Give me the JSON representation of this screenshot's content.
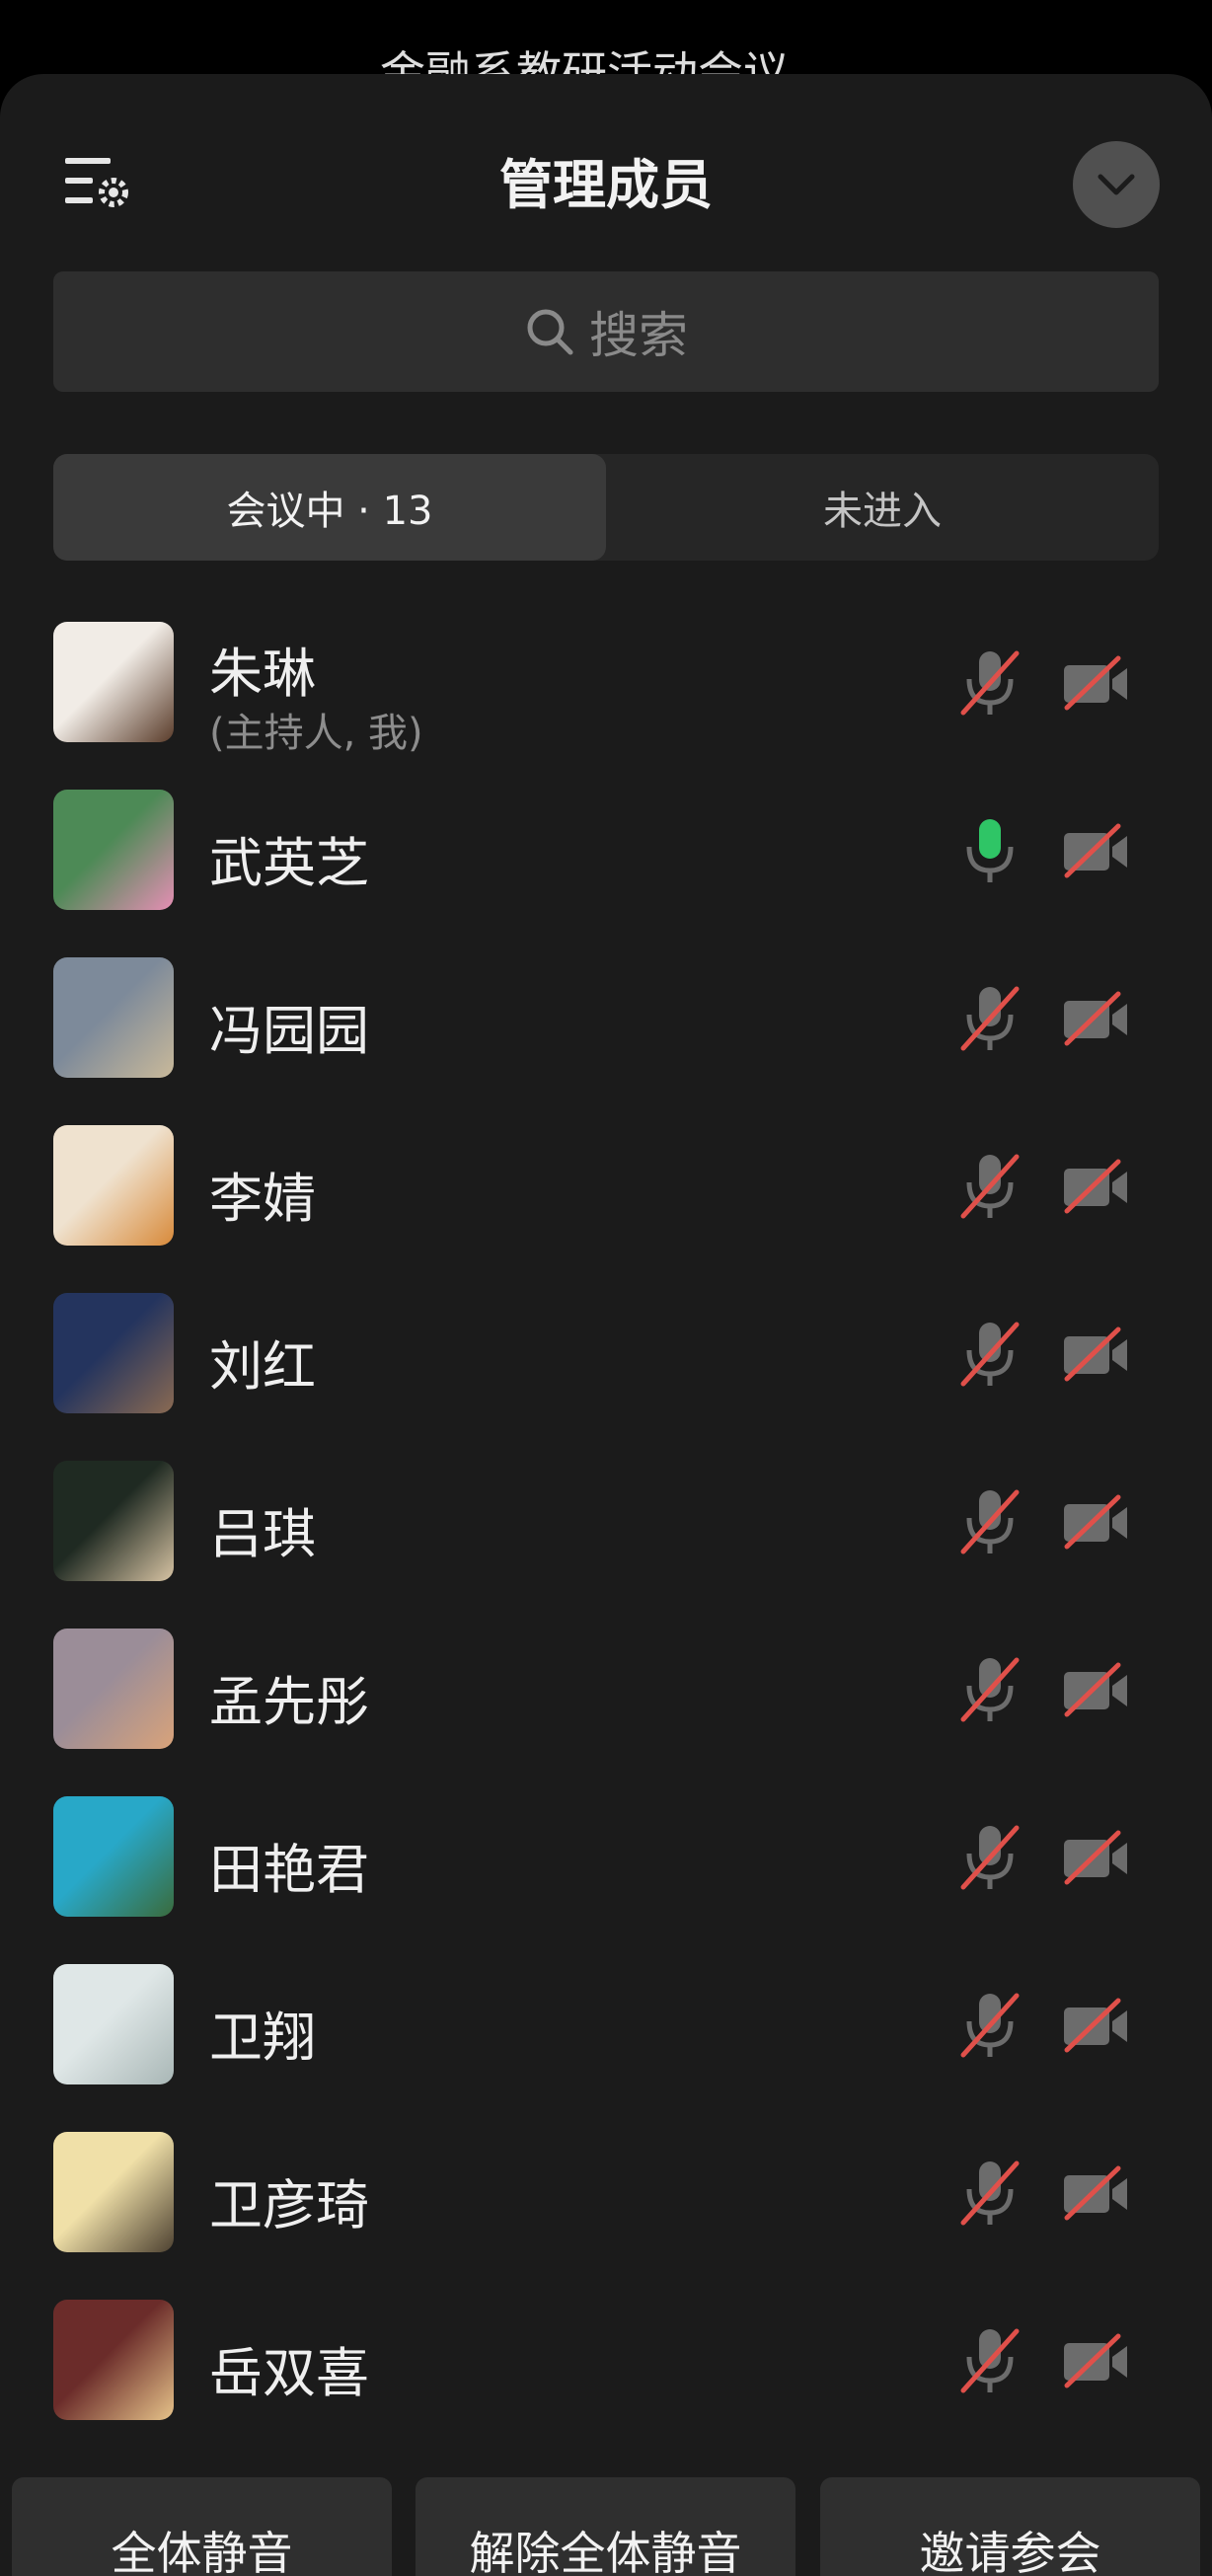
{
  "background": {
    "title": "金融系教研活动会议"
  },
  "sheet": {
    "title": "管理成员"
  },
  "search": {
    "placeholder": "搜索"
  },
  "tabs": [
    {
      "label": "会议中 · 13",
      "active": true
    },
    {
      "label": "未进入",
      "active": false
    }
  ],
  "members": [
    {
      "name": "朱琳",
      "role": "(主持人, 我)",
      "mic": "muted",
      "camera": "off",
      "avatar_colors": [
        "#f1ece6",
        "#5a3c2a"
      ]
    },
    {
      "name": "武英芝",
      "role": "",
      "mic": "on",
      "camera": "off",
      "avatar_colors": [
        "#4d8a56",
        "#e58fb4"
      ]
    },
    {
      "name": "冯园园",
      "role": "",
      "mic": "muted",
      "camera": "off",
      "avatar_colors": [
        "#7d8a9a",
        "#c9b99a"
      ]
    },
    {
      "name": "李婧",
      "role": "",
      "mic": "muted",
      "camera": "off",
      "avatar_colors": [
        "#efe2cf",
        "#d88a3a"
      ]
    },
    {
      "name": "刘红",
      "role": "",
      "mic": "muted",
      "camera": "off",
      "avatar_colors": [
        "#24345e",
        "#8a6a52"
      ]
    },
    {
      "name": "吕琪",
      "role": "",
      "mic": "muted",
      "camera": "off",
      "avatar_colors": [
        "#1f2a22",
        "#d7c3a3"
      ]
    },
    {
      "name": "孟先彤",
      "role": "",
      "mic": "muted",
      "camera": "off",
      "avatar_colors": [
        "#9b8d98",
        "#d9a37a"
      ]
    },
    {
      "name": "田艳君",
      "role": "",
      "mic": "muted",
      "camera": "off",
      "avatar_colors": [
        "#28a8c8",
        "#3a6b3c"
      ]
    },
    {
      "name": "卫翔",
      "role": "",
      "mic": "muted",
      "camera": "off",
      "avatar_colors": [
        "#dfe7e7",
        "#a9b7b6"
      ]
    },
    {
      "name": "卫彦琦",
      "role": "",
      "mic": "muted",
      "camera": "off",
      "avatar_colors": [
        "#f0e0a8",
        "#4d4131"
      ]
    },
    {
      "name": "岳双喜",
      "role": "",
      "mic": "muted",
      "camera": "off",
      "avatar_colors": [
        "#6b2c2a",
        "#e6c38a"
      ]
    }
  ],
  "actions": {
    "mute_all": "全体静音",
    "unmute_all": "解除全体静音",
    "invite": "邀请参会"
  },
  "colors": {
    "mic_on": "#2fc566",
    "muted_slash": "#e0504a",
    "icon_gray": "#6c6c6c"
  }
}
